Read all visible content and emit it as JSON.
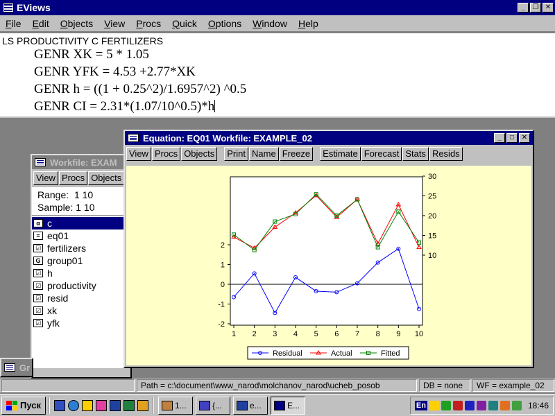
{
  "app": {
    "title": "EViews"
  },
  "menu": [
    {
      "label": "File",
      "u": "F",
      "rest": "ile"
    },
    {
      "label": "Edit",
      "u": "E",
      "rest": "dit"
    },
    {
      "label": "Objects",
      "u": "O",
      "rest": "bjects"
    },
    {
      "label": "View",
      "u": "V",
      "rest": "iew"
    },
    {
      "label": "Procs",
      "u": "P",
      "rest": "rocs"
    },
    {
      "label": "Quick",
      "u": "Q",
      "rest": "uick"
    },
    {
      "label": "Options",
      "u": "O",
      "rest": "ptions"
    },
    {
      "label": "Window",
      "u": "W",
      "rest": "indow"
    },
    {
      "label": "Help",
      "u": "H",
      "rest": "elp"
    }
  ],
  "commands": {
    "first": "LS PRODUCTIVITY C  FERTILIZERS",
    "lines": [
      "GENR XK = 5 * 1.05",
      "GENR YFK = 4.53 +2.77*XK",
      "GENR h = ((1 + 0.25^2)/1.6957^2) ^0.5",
      "GENR CI = 2.31*(1.07/10^0.5)*h"
    ]
  },
  "workfile": {
    "title": "Workfile: EXAM",
    "toolbar": [
      "View",
      "Procs",
      "Objects"
    ],
    "range_label": "Range:",
    "range_value": "1 10",
    "sample_label": "Sample:",
    "sample_value": "1 10",
    "items": [
      {
        "name": "c",
        "icon": "alpha",
        "selected": true
      },
      {
        "name": "eq01",
        "icon": "equation",
        "selected": false
      },
      {
        "name": "fertilizers",
        "icon": "series",
        "selected": false
      },
      {
        "name": "group01",
        "icon": "group",
        "selected": false
      },
      {
        "name": "h",
        "icon": "series",
        "selected": false
      },
      {
        "name": "productivity",
        "icon": "series",
        "selected": false
      },
      {
        "name": "resid",
        "icon": "series",
        "selected": false
      },
      {
        "name": "xk",
        "icon": "series",
        "selected": false
      },
      {
        "name": "yfk",
        "icon": "series",
        "selected": false
      }
    ]
  },
  "minimized": {
    "label": "Gr"
  },
  "equation": {
    "title": "Equation: EQ01   Workfile: EXAMPLE_02",
    "toolbar_a": [
      "View",
      "Procs",
      "Objects"
    ],
    "toolbar_b": [
      "Print",
      "Name",
      "Freeze"
    ],
    "toolbar_c": [
      "Estimate",
      "Forecast",
      "Stats",
      "Resids"
    ]
  },
  "chart_data": {
    "type": "line",
    "x": [
      1,
      2,
      3,
      4,
      5,
      6,
      7,
      8,
      9,
      10
    ],
    "x_ticks": [
      "1",
      "2",
      "3",
      "4",
      "5",
      "6",
      "7",
      "8",
      "9",
      "10"
    ],
    "left_ticks": [
      "2",
      "1",
      "0",
      "-1",
      "-2"
    ],
    "right_ticks": [
      "30",
      "25",
      "20",
      "15",
      "10"
    ],
    "left_ylim": [
      -2,
      2
    ],
    "right_ylim": [
      10,
      30
    ],
    "grid": false,
    "legend_position": "bottom",
    "series": [
      {
        "name": "Residual",
        "axis": "left",
        "color": "#0000ff",
        "marker": "circle",
        "values": [
          -0.65,
          0.55,
          -1.45,
          0.35,
          -0.35,
          -0.4,
          0.05,
          1.1,
          1.8,
          -1.25
        ]
      },
      {
        "name": "Actual",
        "axis": "right",
        "color": "#ff0000",
        "marker": "triangle",
        "values": [
          14.6,
          11.8,
          17.1,
          20.7,
          25.1,
          19.6,
          24.1,
          12.9,
          22.8,
          12.0
        ]
      },
      {
        "name": "Fitted",
        "axis": "right",
        "color": "#008000",
        "marker": "square",
        "values": [
          15.2,
          11.3,
          18.5,
          20.4,
          25.4,
          20.0,
          24.1,
          12.0,
          21.0,
          13.2
        ]
      }
    ]
  },
  "status": {
    "path": "Path = c:\\document\\www_narod\\molchanov_narod\\ucheb_posob",
    "db": "DB = none",
    "wf": "WF = example_02"
  },
  "taskbar": {
    "start": "Пуск",
    "tasks": [
      "1...",
      "{...",
      "e...",
      "E..."
    ],
    "lang": "En",
    "clock": "18:46"
  },
  "colors": {
    "title_active": "#000080",
    "title_inactive": "#808080",
    "chart_bg": "#ffffc8",
    "desktop": "#808080"
  }
}
